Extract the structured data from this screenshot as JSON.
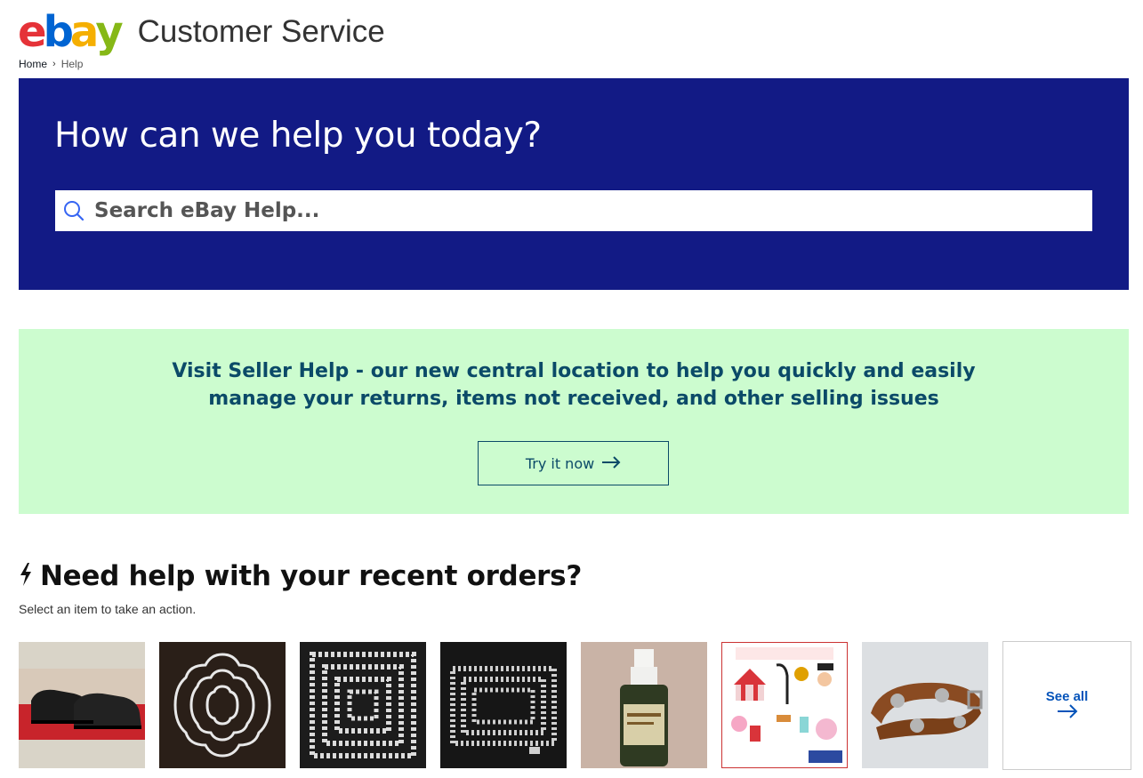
{
  "header": {
    "logo": {
      "e": "e",
      "b": "b",
      "a": "a",
      "y": "y"
    },
    "title": "Customer Service"
  },
  "breadcrumb": {
    "home": "Home",
    "current": "Help"
  },
  "hero": {
    "title": "How can we help you today?",
    "search_placeholder": "Search eBay Help..."
  },
  "promo": {
    "text": "Visit Seller Help - our new central location to help you quickly and easily manage your returns, items not received, and other selling issues",
    "button_label": "Try it now"
  },
  "orders": {
    "title": "Need help with your recent orders?",
    "subtitle": "Select an item to take an action.",
    "items": [
      {
        "icon": "shoes-thumbnail"
      },
      {
        "icon": "nested-die-thumbnail"
      },
      {
        "icon": "square-die-thumbnail"
      },
      {
        "icon": "rectangle-die-thumbnail"
      },
      {
        "icon": "bottle-thumbnail"
      },
      {
        "icon": "circus-dies-thumbnail"
      },
      {
        "icon": "leather-strap-thumbnail"
      }
    ],
    "see_all_label": "See all"
  },
  "colors": {
    "hero_bg": "#121a85",
    "promo_bg": "#ccfccf",
    "promo_text": "#0b4a68",
    "link_blue": "#0654ba"
  }
}
